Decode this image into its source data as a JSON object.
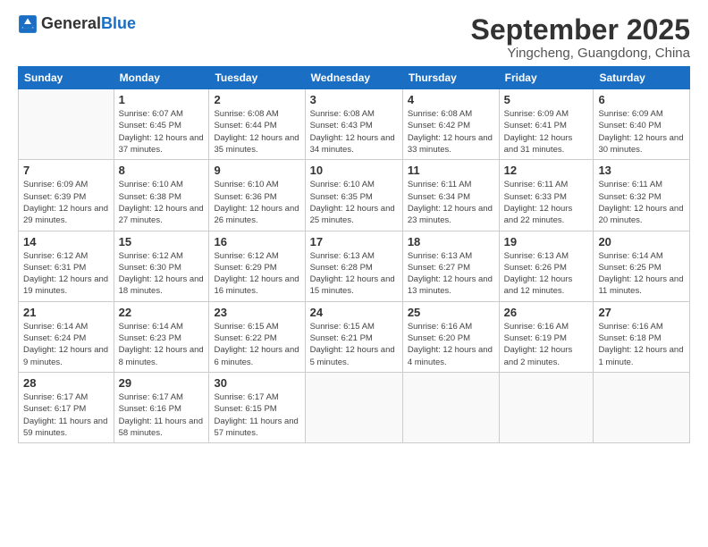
{
  "logo": {
    "general": "General",
    "blue": "Blue"
  },
  "title": "September 2025",
  "location": "Yingcheng, Guangdong, China",
  "weekdays": [
    "Sunday",
    "Monday",
    "Tuesday",
    "Wednesday",
    "Thursday",
    "Friday",
    "Saturday"
  ],
  "weeks": [
    [
      {
        "day": "",
        "info": ""
      },
      {
        "day": "1",
        "info": "Sunrise: 6:07 AM\nSunset: 6:45 PM\nDaylight: 12 hours and 37 minutes."
      },
      {
        "day": "2",
        "info": "Sunrise: 6:08 AM\nSunset: 6:44 PM\nDaylight: 12 hours and 35 minutes."
      },
      {
        "day": "3",
        "info": "Sunrise: 6:08 AM\nSunset: 6:43 PM\nDaylight: 12 hours and 34 minutes."
      },
      {
        "day": "4",
        "info": "Sunrise: 6:08 AM\nSunset: 6:42 PM\nDaylight: 12 hours and 33 minutes."
      },
      {
        "day": "5",
        "info": "Sunrise: 6:09 AM\nSunset: 6:41 PM\nDaylight: 12 hours and 31 minutes."
      },
      {
        "day": "6",
        "info": "Sunrise: 6:09 AM\nSunset: 6:40 PM\nDaylight: 12 hours and 30 minutes."
      }
    ],
    [
      {
        "day": "7",
        "info": "Sunrise: 6:09 AM\nSunset: 6:39 PM\nDaylight: 12 hours and 29 minutes."
      },
      {
        "day": "8",
        "info": "Sunrise: 6:10 AM\nSunset: 6:38 PM\nDaylight: 12 hours and 27 minutes."
      },
      {
        "day": "9",
        "info": "Sunrise: 6:10 AM\nSunset: 6:36 PM\nDaylight: 12 hours and 26 minutes."
      },
      {
        "day": "10",
        "info": "Sunrise: 6:10 AM\nSunset: 6:35 PM\nDaylight: 12 hours and 25 minutes."
      },
      {
        "day": "11",
        "info": "Sunrise: 6:11 AM\nSunset: 6:34 PM\nDaylight: 12 hours and 23 minutes."
      },
      {
        "day": "12",
        "info": "Sunrise: 6:11 AM\nSunset: 6:33 PM\nDaylight: 12 hours and 22 minutes."
      },
      {
        "day": "13",
        "info": "Sunrise: 6:11 AM\nSunset: 6:32 PM\nDaylight: 12 hours and 20 minutes."
      }
    ],
    [
      {
        "day": "14",
        "info": "Sunrise: 6:12 AM\nSunset: 6:31 PM\nDaylight: 12 hours and 19 minutes."
      },
      {
        "day": "15",
        "info": "Sunrise: 6:12 AM\nSunset: 6:30 PM\nDaylight: 12 hours and 18 minutes."
      },
      {
        "day": "16",
        "info": "Sunrise: 6:12 AM\nSunset: 6:29 PM\nDaylight: 12 hours and 16 minutes."
      },
      {
        "day": "17",
        "info": "Sunrise: 6:13 AM\nSunset: 6:28 PM\nDaylight: 12 hours and 15 minutes."
      },
      {
        "day": "18",
        "info": "Sunrise: 6:13 AM\nSunset: 6:27 PM\nDaylight: 12 hours and 13 minutes."
      },
      {
        "day": "19",
        "info": "Sunrise: 6:13 AM\nSunset: 6:26 PM\nDaylight: 12 hours and 12 minutes."
      },
      {
        "day": "20",
        "info": "Sunrise: 6:14 AM\nSunset: 6:25 PM\nDaylight: 12 hours and 11 minutes."
      }
    ],
    [
      {
        "day": "21",
        "info": "Sunrise: 6:14 AM\nSunset: 6:24 PM\nDaylight: 12 hours and 9 minutes."
      },
      {
        "day": "22",
        "info": "Sunrise: 6:14 AM\nSunset: 6:23 PM\nDaylight: 12 hours and 8 minutes."
      },
      {
        "day": "23",
        "info": "Sunrise: 6:15 AM\nSunset: 6:22 PM\nDaylight: 12 hours and 6 minutes."
      },
      {
        "day": "24",
        "info": "Sunrise: 6:15 AM\nSunset: 6:21 PM\nDaylight: 12 hours and 5 minutes."
      },
      {
        "day": "25",
        "info": "Sunrise: 6:16 AM\nSunset: 6:20 PM\nDaylight: 12 hours and 4 minutes."
      },
      {
        "day": "26",
        "info": "Sunrise: 6:16 AM\nSunset: 6:19 PM\nDaylight: 12 hours and 2 minutes."
      },
      {
        "day": "27",
        "info": "Sunrise: 6:16 AM\nSunset: 6:18 PM\nDaylight: 12 hours and 1 minute."
      }
    ],
    [
      {
        "day": "28",
        "info": "Sunrise: 6:17 AM\nSunset: 6:17 PM\nDaylight: 11 hours and 59 minutes."
      },
      {
        "day": "29",
        "info": "Sunrise: 6:17 AM\nSunset: 6:16 PM\nDaylight: 11 hours and 58 minutes."
      },
      {
        "day": "30",
        "info": "Sunrise: 6:17 AM\nSunset: 6:15 PM\nDaylight: 11 hours and 57 minutes."
      },
      {
        "day": "",
        "info": ""
      },
      {
        "day": "",
        "info": ""
      },
      {
        "day": "",
        "info": ""
      },
      {
        "day": "",
        "info": ""
      }
    ]
  ]
}
